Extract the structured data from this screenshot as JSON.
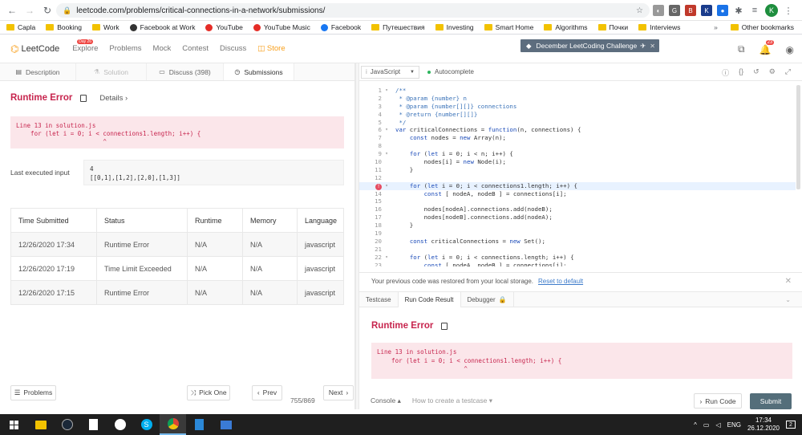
{
  "browser": {
    "url": "leetcode.com/problems/critical-connections-in-a-network/submissions/",
    "profile_initial": "K",
    "bookmarks": [
      "Capla",
      "Booking",
      "Work",
      "Facebook at Work",
      "YouTube",
      "YouTube Music",
      "Facebook",
      "Путешествия",
      "Investing",
      "Smart Home",
      "Algorithms",
      "Почки",
      "Interviews"
    ],
    "more_bookmarks": "»",
    "other_bookmarks": "Other bookmarks"
  },
  "lc_nav": {
    "logo": "LeetCode",
    "menu": [
      "Explore",
      "Problems",
      "Mock",
      "Contest",
      "Discuss",
      "Store"
    ],
    "day_badge": "Day 26",
    "challenge_banner": "December LeetCoding Challenge",
    "notification_count": "23"
  },
  "left_tabs": [
    "Description",
    "Solution",
    "Discuss (398)",
    "Submissions"
  ],
  "result": {
    "title": "Runtime Error",
    "details": "Details",
    "error_text": "Line 13 in solution.js\n    for (let i = 0; i < connections1.length; i++) {\n                        ^",
    "last_input_label": "Last executed input",
    "last_input_value": "4\n[[0,1],[1,2],[2,0],[1,3]]"
  },
  "submissions": {
    "headers": [
      "Time Submitted",
      "Status",
      "Runtime",
      "Memory",
      "Language"
    ],
    "rows": [
      [
        "12/26/2020 17:34",
        "Runtime Error",
        "N/A",
        "N/A",
        "javascript"
      ],
      [
        "12/26/2020 17:19",
        "Time Limit Exceeded",
        "N/A",
        "N/A",
        "javascript"
      ],
      [
        "12/26/2020 17:15",
        "Runtime Error",
        "N/A",
        "N/A",
        "javascript"
      ]
    ]
  },
  "left_footer": {
    "problems": "Problems",
    "pick_one": "Pick One",
    "prev": "Prev",
    "page": "755/869",
    "next": "Next"
  },
  "editor": {
    "language": "JavaScript",
    "autocomplete": "Autocomplete",
    "lines": [
      "/**",
      " * @param {number} n",
      " * @param {number[][]} connections",
      " * @return {number[][]}",
      " */",
      "var criticalConnections = function(n, connections) {",
      "    const nodes = new Array(n);",
      "",
      "    for (let i = 0; i < n; i++) {",
      "        nodes[i] = new Node(i);",
      "    }",
      "",
      "    for (let i = 0; i < connections1.length; i++) {",
      "        const [ nodeA, nodeB ] = connections[i];",
      "",
      "        nodes[nodeA].connections.add(nodeB);",
      "        nodes[nodeB].connections.add(nodeA);",
      "    }",
      "",
      "    const criticalConnections = new Set();",
      "",
      "    for (let i = 0; i < connections.length; i++) {",
      "        const [ nodeA, nodeB ] = connections[i];"
    ]
  },
  "restore_msg": "Your previous code was restored from your local storage.",
  "reset_link": "Reset to default",
  "console_tabs": [
    "Testcase",
    "Run Code Result",
    "Debugger"
  ],
  "run_result": {
    "title": "Runtime Error",
    "error_text": "Line 13 in solution.js\n    for (let i = 0; i < connections1.length; i++) {\n                        ^"
  },
  "right_footer": {
    "console": "Console",
    "create_testcase": "How to create a testcase",
    "run_code": "Run Code",
    "submit": "Submit"
  },
  "taskbar": {
    "lang": "ENG",
    "time": "17:34",
    "date": "26.12.2020",
    "notif": "2"
  }
}
